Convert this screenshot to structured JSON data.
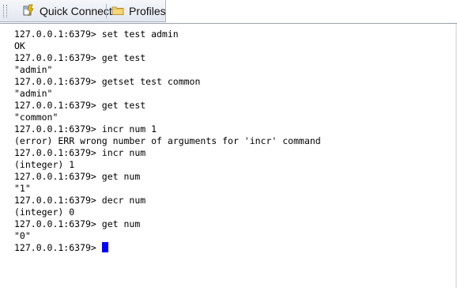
{
  "toolbar": {
    "quick_connect_label": "Quick Connect",
    "profiles_label": "Profiles",
    "quick_connect_icon": "quick-connect-icon",
    "profiles_icon": "folder-icon"
  },
  "terminal": {
    "prompt": "127.0.0.1:6379> ",
    "cursor_color": "#0000ff",
    "lines": [
      "127.0.0.1:6379> set test admin",
      "OK",
      "127.0.0.1:6379> get test",
      "\"admin\"",
      "127.0.0.1:6379> getset test common",
      "\"admin\"",
      "127.0.0.1:6379> get test",
      "\"common\"",
      "127.0.0.1:6379> incr num 1",
      "(error) ERR wrong number of arguments for 'incr' command",
      "127.0.0.1:6379> incr num",
      "(integer) 1",
      "127.0.0.1:6379> get num",
      "\"1\"",
      "127.0.0.1:6379> decr num",
      "(integer) 0",
      "127.0.0.1:6379> get num",
      "\"0\""
    ]
  }
}
